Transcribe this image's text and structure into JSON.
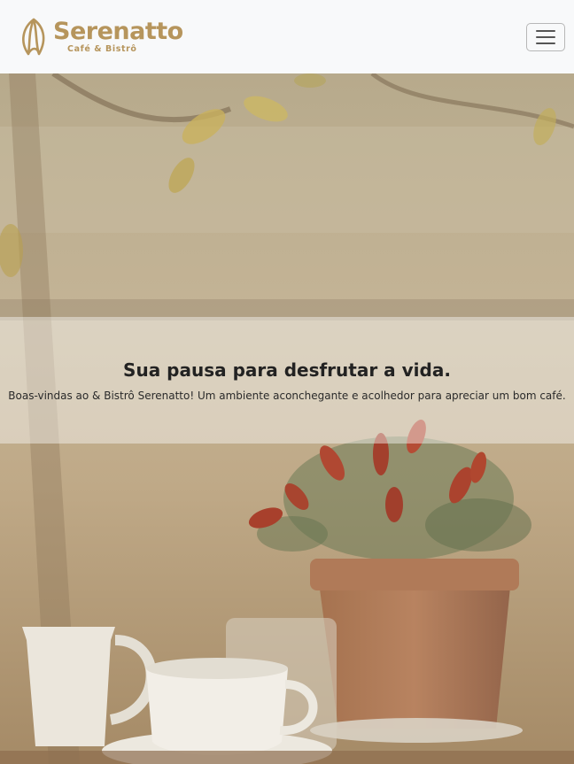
{
  "navbar": {
    "brand_name": "Serenatto",
    "brand_subtitle": "Café & Bistrô",
    "logo_icon": "coffee-bean-logo-icon",
    "toggler_icon": "hamburger-menu-icon",
    "brand_color": "#b6955c"
  },
  "hero": {
    "title": "Sua pausa para desfrutar a vida.",
    "subtitle": "Boas-vindas ao & Bistrô Serenatto! Um ambiente aconchegante e acolhedor para apreciar um bom café."
  }
}
